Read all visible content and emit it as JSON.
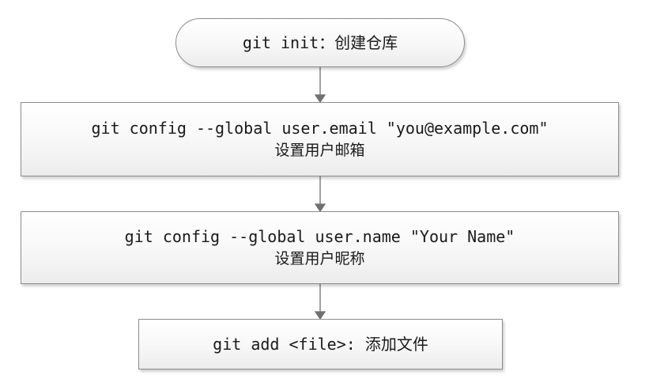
{
  "diagram": {
    "type": "flowchart",
    "nodes": [
      {
        "id": "init",
        "shape": "terminal",
        "lines": [
          "git init：创建仓库"
        ]
      },
      {
        "id": "email",
        "shape": "process",
        "lines": [
          "git config --global user.email \"you@example.com\"",
          "设置用户邮箱"
        ]
      },
      {
        "id": "name",
        "shape": "process",
        "lines": [
          "git config --global user.name \"Your Name\"",
          "设置用户昵称"
        ]
      },
      {
        "id": "add",
        "shape": "process",
        "lines": [
          "git add <file>: 添加文件"
        ]
      }
    ],
    "edges": [
      {
        "from": "init",
        "to": "email"
      },
      {
        "from": "email",
        "to": "name"
      },
      {
        "from": "name",
        "to": "add"
      }
    ],
    "colors": {
      "border": "#8c8c8c",
      "connector": "#707070",
      "text": "#1a1a1a"
    }
  }
}
